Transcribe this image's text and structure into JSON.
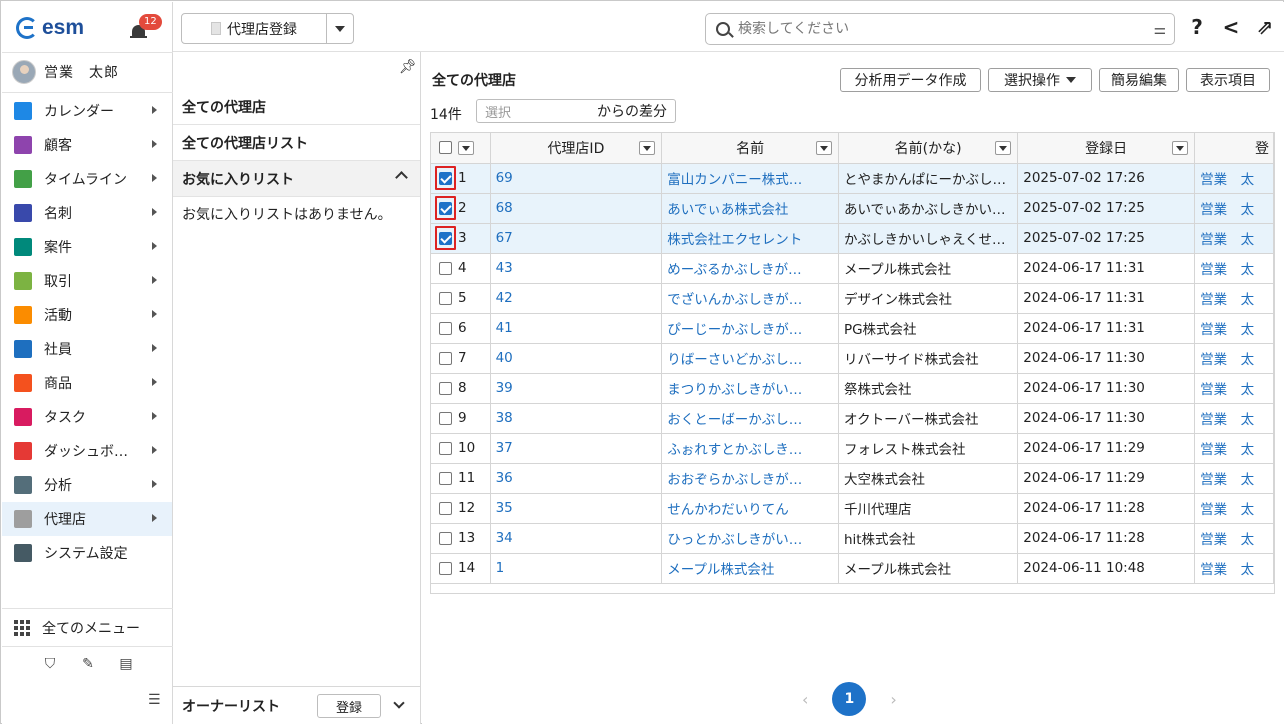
{
  "app": {
    "logo_text": "esm",
    "notification_count": "12"
  },
  "user": {
    "name": "営業　太郎"
  },
  "nav": {
    "items": [
      {
        "label": "カレンダー",
        "icon": "calendar-icon",
        "color": "#1e88e5"
      },
      {
        "label": "顧客",
        "icon": "building-icon",
        "color": "#8e44ad"
      },
      {
        "label": "タイムライン",
        "icon": "chat-icon",
        "color": "#43a047"
      },
      {
        "label": "名刺",
        "icon": "card-icon",
        "color": "#3949ab"
      },
      {
        "label": "案件",
        "icon": "folder-icon",
        "color": "#00897b"
      },
      {
        "label": "取引",
        "icon": "ledger-icon",
        "color": "#7cb342"
      },
      {
        "label": "活動",
        "icon": "clipboard-icon",
        "color": "#fb8c00"
      },
      {
        "label": "社員",
        "icon": "person-icon",
        "color": "#1e6fbf"
      },
      {
        "label": "商品",
        "icon": "box-icon",
        "color": "#f4511e"
      },
      {
        "label": "タスク",
        "icon": "task-icon",
        "color": "#d81b60"
      },
      {
        "label": "ダッシュボ…",
        "icon": "dashboard-icon",
        "color": "#e53935"
      },
      {
        "label": "分析",
        "icon": "chart-icon",
        "color": "#546e7a"
      },
      {
        "label": "代理店",
        "icon": "document-icon",
        "color": "#9e9e9e"
      },
      {
        "label": "システム設定",
        "icon": "gear-icon",
        "color": "#455a64"
      }
    ],
    "all_menu_label": "全てのメニュー"
  },
  "topbar": {
    "view_label": "代理店登録",
    "search_placeholder": "検索してください",
    "help": "?",
    "share": "<",
    "open": "⇗"
  },
  "list_pane": {
    "all_agencies": "全ての代理店",
    "all_agency_list": "全ての代理店リスト",
    "favorites_header": "お気に入りリスト",
    "favorites_empty": "お気に入りリストはありません。",
    "owner_list": "オーナーリスト",
    "register_button": "登録"
  },
  "main": {
    "title": "全ての代理店",
    "buttons": {
      "analysis": "分析用データ作成",
      "select_ops": "選択操作",
      "quick_edit": "簡易編集",
      "display_items": "表示項目"
    },
    "count": "14件",
    "diff_placeholder": "選択",
    "diff_label": "からの差分",
    "columns": [
      "代理店ID",
      "名前",
      "名前(かな)",
      "登録日",
      "登"
    ],
    "rows": [
      {
        "n": "1",
        "id": "69",
        "name": "富山カンパニー株式…",
        "kana": "とやまかんぱにーかぶし…",
        "date": "2025-07-02 17:26",
        "owner": "営業　太",
        "checked": true
      },
      {
        "n": "2",
        "id": "68",
        "name": "あいでぃあ株式会社",
        "kana": "あいでぃあかぶしきかい…",
        "date": "2025-07-02 17:25",
        "owner": "営業　太",
        "checked": true
      },
      {
        "n": "3",
        "id": "67",
        "name": "株式会社エクセレント",
        "kana": "かぶしきかいしゃえくせ…",
        "date": "2025-07-02 17:25",
        "owner": "営業　太",
        "checked": true
      },
      {
        "n": "4",
        "id": "43",
        "name": "めーぷるかぶしきが…",
        "kana": "メープル株式会社",
        "date": "2024-06-17 11:31",
        "owner": "営業　太",
        "checked": false
      },
      {
        "n": "5",
        "id": "42",
        "name": "でざいんかぶしきが…",
        "kana": "デザイン株式会社",
        "date": "2024-06-17 11:31",
        "owner": "営業　太",
        "checked": false
      },
      {
        "n": "6",
        "id": "41",
        "name": "ぴーじーかぶしきが…",
        "kana": "PG株式会社",
        "date": "2024-06-17 11:31",
        "owner": "営業　太",
        "checked": false
      },
      {
        "n": "7",
        "id": "40",
        "name": "りばーさいどかぶし…",
        "kana": "リバーサイド株式会社",
        "date": "2024-06-17 11:30",
        "owner": "営業　太",
        "checked": false
      },
      {
        "n": "8",
        "id": "39",
        "name": "まつりかぶしきがい…",
        "kana": "祭株式会社",
        "date": "2024-06-17 11:30",
        "owner": "営業　太",
        "checked": false
      },
      {
        "n": "9",
        "id": "38",
        "name": "おくとーばーかぶし…",
        "kana": "オクトーバー株式会社",
        "date": "2024-06-17 11:30",
        "owner": "営業　太",
        "checked": false
      },
      {
        "n": "10",
        "id": "37",
        "name": "ふぉれすとかぶしき…",
        "kana": "フォレスト株式会社",
        "date": "2024-06-17 11:29",
        "owner": "営業　太",
        "checked": false
      },
      {
        "n": "11",
        "id": "36",
        "name": "おおぞらかぶしきが…",
        "kana": "大空株式会社",
        "date": "2024-06-17 11:29",
        "owner": "営業　太",
        "checked": false
      },
      {
        "n": "12",
        "id": "35",
        "name": "せんかわだいりてん",
        "kana": "千川代理店",
        "date": "2024-06-17 11:28",
        "owner": "営業　太",
        "checked": false
      },
      {
        "n": "13",
        "id": "34",
        "name": "ひっとかぶしきがい…",
        "kana": "hit株式会社",
        "date": "2024-06-17 11:28",
        "owner": "営業　太",
        "checked": false
      },
      {
        "n": "14",
        "id": "1",
        "name": "メープル株式会社",
        "kana": "メープル株式会社",
        "date": "2024-06-11 10:48",
        "owner": "営業　太",
        "checked": false
      }
    ],
    "current_page": "1"
  },
  "colors": {
    "accent": "#1e72c8",
    "link": "#1f6fbf",
    "selected_row": "#e8f3fb",
    "highlight": "#dd2222"
  }
}
